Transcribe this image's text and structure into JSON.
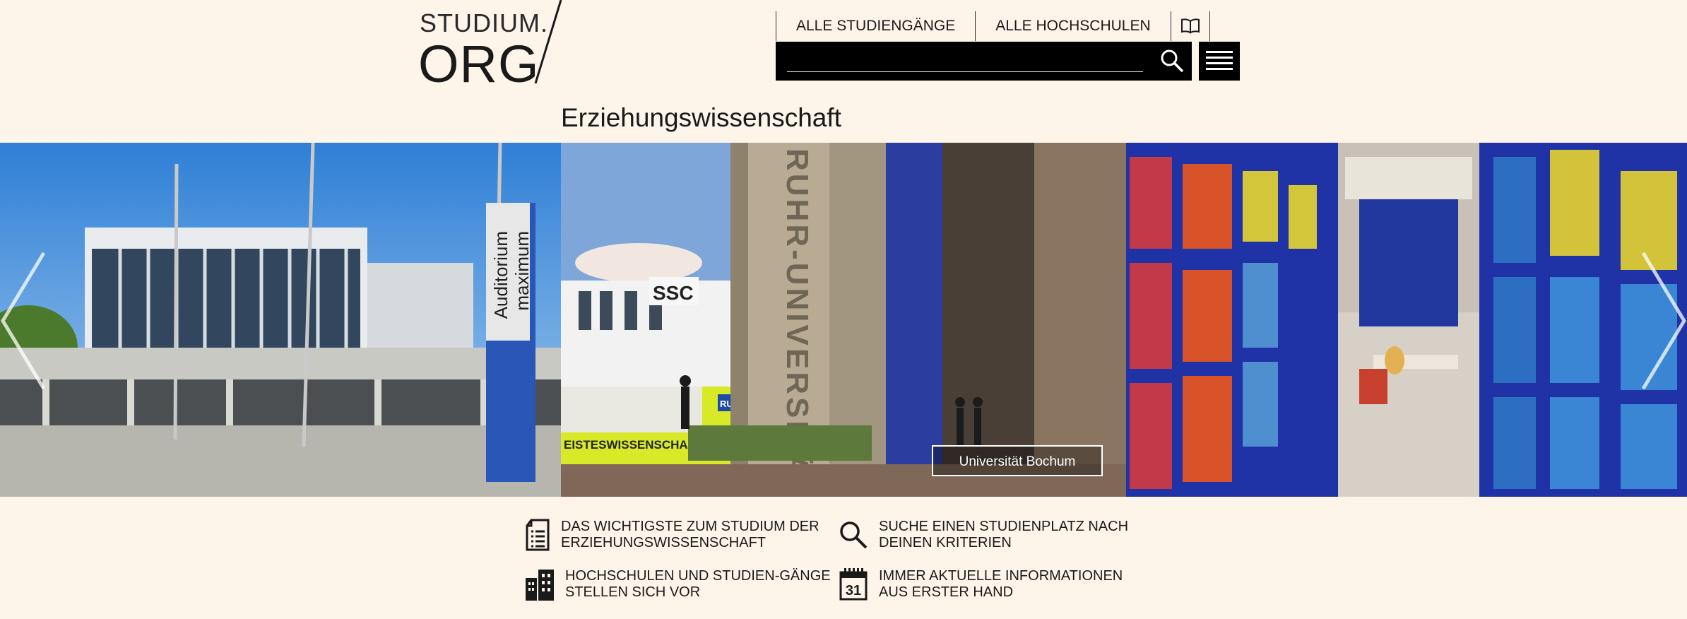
{
  "logo": {
    "line1": "STUDIUM.",
    "line2": "ORG"
  },
  "nav": {
    "all_programs": "ALLE STUDIENGÄNGE",
    "all_universities": "ALLE HOCHSCHULEN",
    "book_icon": "book-icon"
  },
  "search": {
    "value": "",
    "placeholder": "",
    "icon": "search-icon"
  },
  "menu": {
    "icon": "hamburger-icon"
  },
  "page": {
    "title": "Erziehungswissenschaft"
  },
  "carousel": {
    "caption": "Universität Bochum",
    "photos": [
      "auditorium-maximum-photo",
      "ruhr-universitaet-photo",
      "library-shelves-photo"
    ],
    "photo_texts": {
      "auditorium_sign_1": "Auditorium",
      "auditorium_sign_2": "maximum",
      "ssc": "SSC",
      "building_sign": "RUHR-UNIVERSITÄT",
      "banner": "EISTESWISSENSCHAFTEN",
      "banner_logo": "RUB"
    }
  },
  "features": [
    {
      "icon": "document-list-icon",
      "line1": "DAS WICHTIGSTE ZUM STUDIUM DER",
      "line2": "ERZIEHUNGSWISSENSCHAFT"
    },
    {
      "icon": "magnifier-icon",
      "line1": "SUCHE EINEN STUDIENPLATZ NACH",
      "line2": "DEINEN KRITERIEN"
    },
    {
      "icon": "buildings-icon",
      "line1": "HOCHSCHULEN UND STUDIEN-GÄNGE",
      "line2": "STELLEN SICH VOR"
    },
    {
      "icon": "calendar-icon",
      "line1": "IMMER AKTUELLE INFORMATIONEN",
      "line2": "AUS ERSTER HAND",
      "day": "31"
    }
  ],
  "colors": {
    "background": "#fdf4ea",
    "bar": "#000000",
    "text": "#1a1a1a"
  }
}
